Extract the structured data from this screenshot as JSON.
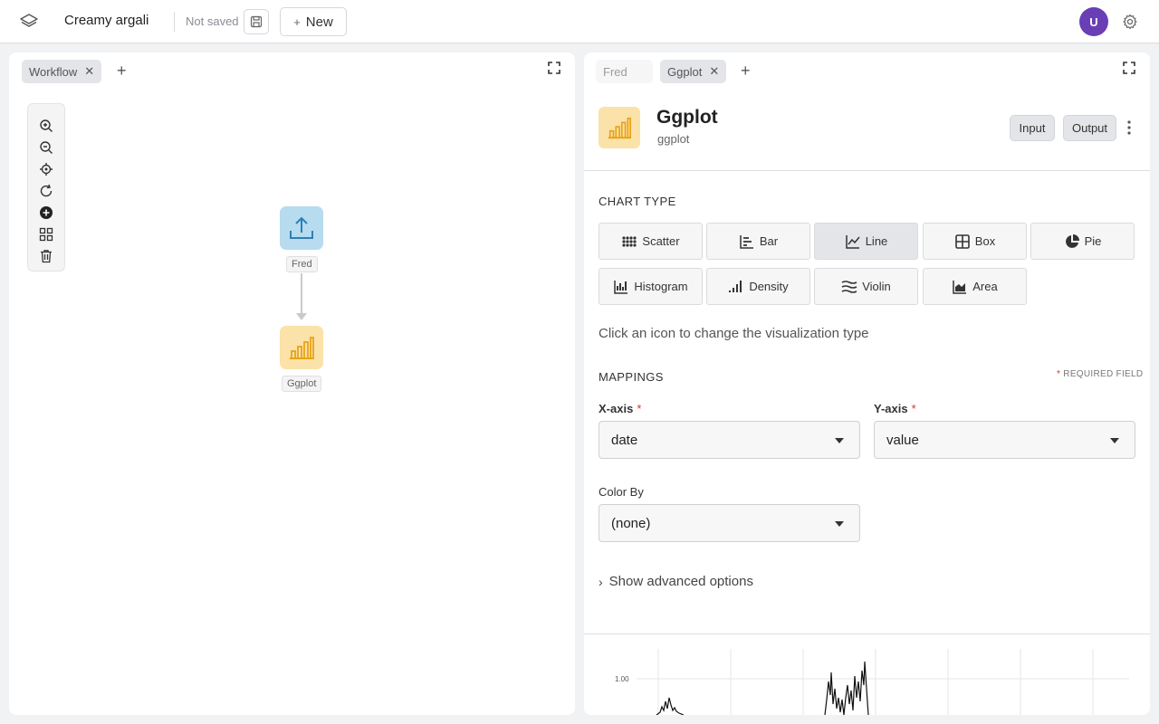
{
  "topbar": {
    "title": "Creamy argali",
    "save_status": "Not saved",
    "new_label": "New",
    "avatar_initial": "U"
  },
  "workflow_panel": {
    "tabs": [
      {
        "label": "Workflow",
        "active": true
      }
    ],
    "nodes": [
      {
        "label": "Fred",
        "icon": "upload-icon",
        "color": "#b7dbef"
      },
      {
        "label": "Ggplot",
        "icon": "bar-chart-icon",
        "color": "#fbe2a8"
      }
    ],
    "tools": [
      "zoom-in-icon",
      "zoom-out-icon",
      "locate-icon",
      "refresh-icon",
      "add-circle-icon",
      "layout-icon",
      "trash-icon"
    ]
  },
  "detail_panel": {
    "tabs": [
      {
        "label": "Fred",
        "active": false
      },
      {
        "label": "Ggplot",
        "active": true
      }
    ],
    "node": {
      "title": "Ggplot",
      "subtitle": "ggplot"
    },
    "input_label": "Input",
    "output_label": "Output",
    "chart_type": {
      "heading": "Chart Type",
      "options": [
        {
          "label": "Scatter",
          "icon": "scatter-icon"
        },
        {
          "label": "Bar",
          "icon": "bar-icon"
        },
        {
          "label": "Line",
          "icon": "line-icon",
          "selected": true
        },
        {
          "label": "Box",
          "icon": "box-icon"
        },
        {
          "label": "Pie",
          "icon": "pie-icon"
        },
        {
          "label": "Histogram",
          "icon": "histogram-icon"
        },
        {
          "label": "Density",
          "icon": "density-icon"
        },
        {
          "label": "Violin",
          "icon": "violin-icon"
        },
        {
          "label": "Area",
          "icon": "area-icon"
        }
      ],
      "hint": "Click an icon to change the visualization type"
    },
    "mappings": {
      "heading": "Mappings",
      "required_note": "Required field",
      "x_label": "X-axis",
      "x_value": "date",
      "y_label": "Y-axis",
      "y_value": "value",
      "color_label": "Color By",
      "color_value": "(none)"
    },
    "advanced_label": "Show advanced options",
    "preview": {
      "tick_label": "1.00"
    }
  },
  "colors": {
    "accent": "#6a3fb5",
    "ggplot_icon": "#e8a317",
    "fred_icon": "#2f7fb5",
    "required": "#d8322b"
  }
}
